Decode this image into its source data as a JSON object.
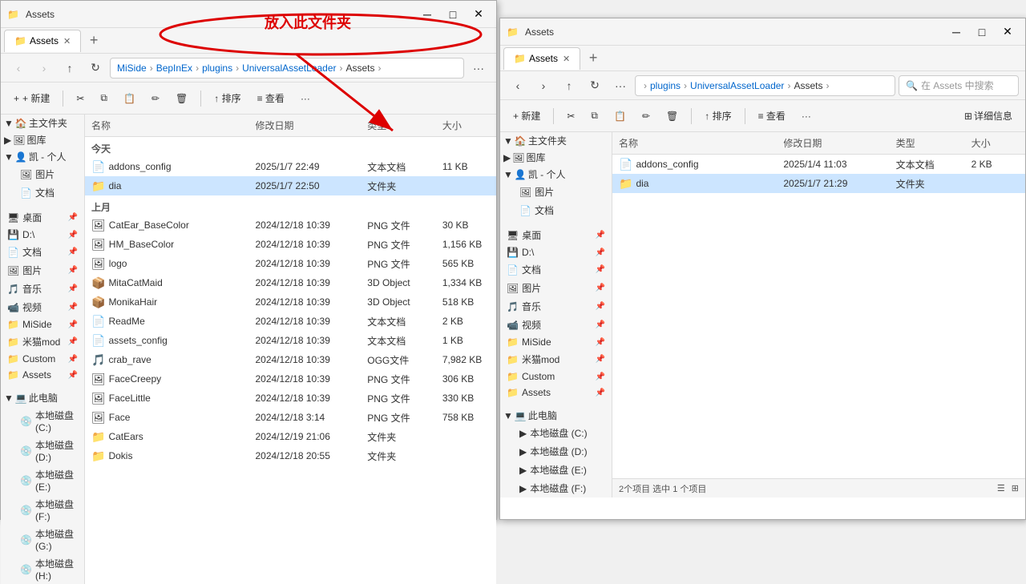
{
  "win1": {
    "title": "Assets",
    "tab_label": "Assets",
    "nav": {
      "back": "‹",
      "forward": "›",
      "up": "↑",
      "refresh": "↻",
      "breadcrumbs": [
        "MiSide",
        "BepInEx",
        "plugins",
        "UniversalAssetLoader",
        "Assets"
      ],
      "more": "···"
    },
    "toolbar": {
      "new": "+ 新建",
      "cut": "✂",
      "copy": "⧉",
      "paste": "📋",
      "rename": "✏",
      "delete": "🗑",
      "sort": "排序",
      "view": "≡ 查看",
      "more": "···"
    },
    "columns": {
      "name": "名称",
      "date": "修改日期",
      "type": "类型",
      "size": "大小"
    },
    "sidebar": {
      "sections": [
        {
          "label": "主文件夹",
          "icon": "🏠",
          "expanded": true,
          "children": []
        },
        {
          "label": "图库",
          "icon": "🖼",
          "children": []
        },
        {
          "label": "凯 - 个人",
          "icon": "👤",
          "expanded": true,
          "children": [
            {
              "label": "图片",
              "icon": "🖼"
            },
            {
              "label": "文档",
              "icon": "📄"
            }
          ]
        },
        {
          "label": "桌面",
          "icon": "🖥",
          "pin": true
        },
        {
          "label": "D:\\",
          "icon": "💾",
          "pin": true
        },
        {
          "label": "文档",
          "icon": "📄",
          "pin": true
        },
        {
          "label": "图片",
          "icon": "🖼",
          "pin": true
        },
        {
          "label": "音乐",
          "icon": "🎵",
          "pin": true
        },
        {
          "label": "视频",
          "icon": "📹",
          "pin": true
        },
        {
          "label": "MiSide",
          "icon": "📁",
          "pin": true
        },
        {
          "label": "米猫mod",
          "icon": "📁",
          "pin": true
        },
        {
          "label": "Custom",
          "icon": "📁",
          "pin": true
        },
        {
          "label": "Assets",
          "icon": "📁",
          "pin": true
        }
      ],
      "pc_section": {
        "label": "此电脑",
        "expanded": true,
        "drives": [
          "本地磁盘 (C:)",
          "本地磁盘 (D:)",
          "本地磁盘 (E:)",
          "本地磁盘 (F:)",
          "本地磁盘 (G:)",
          "本地磁盘 (H:)"
        ]
      }
    },
    "files": {
      "today": {
        "label": "今天",
        "items": [
          {
            "name": "addons_config",
            "date": "2025/1/7 22:49",
            "type": "文本文档",
            "size": "11 KB",
            "icon": "📄"
          },
          {
            "name": "dia",
            "date": "2025/1/7 22:50",
            "type": "文件夹",
            "size": "",
            "icon": "📁",
            "selected": true
          }
        ]
      },
      "last_month": {
        "label": "上月",
        "items": [
          {
            "name": "CatEar_BaseColor",
            "date": "2024/12/18 10:39",
            "type": "PNG 文件",
            "size": "30 KB",
            "icon": "🖼"
          },
          {
            "name": "HM_BaseColor",
            "date": "2024/12/18 10:39",
            "type": "PNG 文件",
            "size": "1,156 KB",
            "icon": "🖼"
          },
          {
            "name": "logo",
            "date": "2024/12/18 10:39",
            "type": "PNG 文件",
            "size": "565 KB",
            "icon": "🖼"
          },
          {
            "name": "MitaCatMaid",
            "date": "2024/12/18 10:39",
            "type": "3D Object",
            "size": "1,334 KB",
            "icon": "📦"
          },
          {
            "name": "MonikaHair",
            "date": "2024/12/18 10:39",
            "type": "3D Object",
            "size": "518 KB",
            "icon": "📦"
          },
          {
            "name": "ReadMe",
            "date": "2024/12/18 10:39",
            "type": "文本文档",
            "size": "2 KB",
            "icon": "📄"
          },
          {
            "name": "assets_config",
            "date": "2024/12/18 10:39",
            "type": "文本文档",
            "size": "1 KB",
            "icon": "📄"
          },
          {
            "name": "crab_rave",
            "date": "2024/12/18 10:39",
            "type": "OGG文件",
            "size": "7,982 KB",
            "icon": "🎵"
          },
          {
            "name": "FaceCreepy",
            "date": "2024/12/18 10:39",
            "type": "PNG 文件",
            "size": "306 KB",
            "icon": "🖼"
          },
          {
            "name": "FaceLittle",
            "date": "2024/12/18 10:39",
            "type": "PNG 文件",
            "size": "330 KB",
            "icon": "🖼"
          },
          {
            "name": "Face",
            "date": "2024/12/18 3:14",
            "type": "PNG 文件",
            "size": "758 KB",
            "icon": "🖼"
          },
          {
            "name": "CatEars",
            "date": "2024/12/19 21:06",
            "type": "文件夹",
            "size": "",
            "icon": "📁"
          },
          {
            "name": "Dokis",
            "date": "2024/12/18 20:55",
            "type": "文件夹",
            "size": "",
            "icon": "📁"
          }
        ]
      }
    }
  },
  "win2": {
    "title": "Assets",
    "tab_label": "Assets",
    "nav": {
      "breadcrumbs": [
        "plugins",
        "UniversalAssetLoader",
        "Assets"
      ],
      "search_placeholder": "在 Assets 中搜索"
    },
    "toolbar": {
      "new": "+ 新建",
      "sort": "↑ 排序",
      "view": "≡ 查看",
      "detail": "详细信息",
      "more": "···"
    },
    "columns": {
      "name": "名称",
      "date": "修改日期",
      "type": "类型",
      "size": "大小"
    },
    "sidebar": {
      "quick_access": {
        "label": "主文件夹",
        "icon": "🏠"
      },
      "gallery": {
        "label": "图库",
        "icon": "🖼"
      },
      "personal": {
        "label": "凯 - 个人",
        "icon": "👤",
        "expanded": true,
        "children": [
          {
            "label": "图片",
            "icon": "🖼"
          },
          {
            "label": "文档",
            "icon": "📄"
          }
        ]
      },
      "pinned": [
        {
          "label": "桌面",
          "icon": "🖥",
          "pin": true
        },
        {
          "label": "D:\\",
          "icon": "💾",
          "pin": true
        },
        {
          "label": "文档",
          "icon": "📄",
          "pin": true
        },
        {
          "label": "图片",
          "icon": "🖼",
          "pin": true
        },
        {
          "label": "音乐",
          "icon": "🎵",
          "pin": true
        },
        {
          "label": "视频",
          "icon": "📹",
          "pin": true
        },
        {
          "label": "MiSide",
          "icon": "📁",
          "pin": true
        },
        {
          "label": "米猫mod",
          "icon": "📁",
          "pin": true
        },
        {
          "label": "Custom",
          "icon": "📁",
          "pin": true
        },
        {
          "label": "Assets",
          "icon": "📁",
          "pin": true
        }
      ],
      "pc_section": {
        "label": "此电脑",
        "expanded": true,
        "drives": [
          "本地磁盘 (C:)",
          "本地磁盘 (D:)",
          "本地磁盘 (E:)",
          "本地磁盘 (F:)"
        ]
      }
    },
    "files": [
      {
        "name": "addons_config",
        "date": "2025/1/4 11:03",
        "type": "文本文档",
        "size": "2 KB",
        "icon": "📄"
      },
      {
        "name": "dia",
        "date": "2025/1/7 21:29",
        "type": "文件夹",
        "size": "",
        "icon": "📁",
        "selected": true
      }
    ],
    "status": "2个项目   选中 1 个项目"
  },
  "annotation": {
    "text": "放入此文件夹",
    "oval_hint": "circle around breadcrumb",
    "arrow_hint": "red arrow pointing to dia folder"
  }
}
